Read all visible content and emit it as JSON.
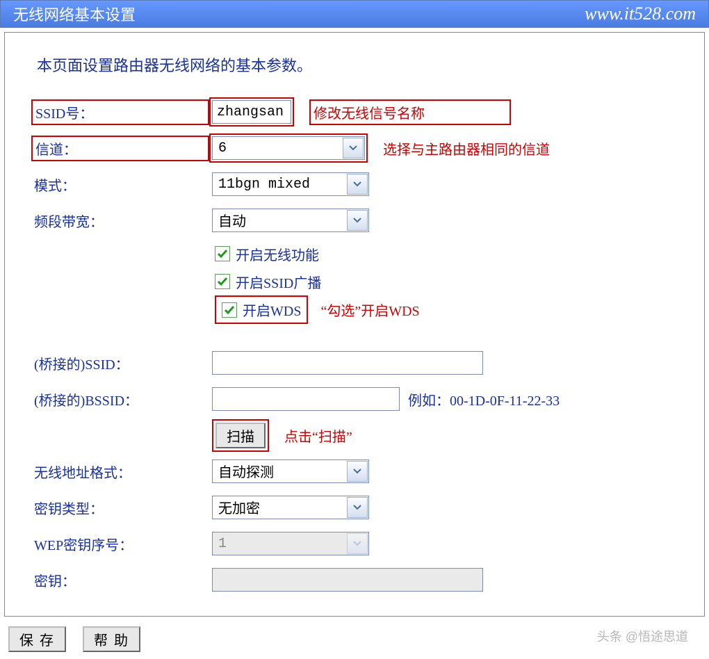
{
  "titlebar": {
    "title": "无线网络基本设置",
    "site": "www.it528.com"
  },
  "intro": "本页面设置路由器无线网络的基本参数。",
  "fields": {
    "ssid": {
      "label": "SSID号：",
      "value": "zhangsan",
      "note": "修改无线信号名称"
    },
    "channel": {
      "label": "信道：",
      "value": "6",
      "note": "选择与主路由器相同的信道"
    },
    "mode": {
      "label": "模式：",
      "value": "11bgn mixed"
    },
    "bandwidth": {
      "label": "频段带宽：",
      "value": "自动"
    },
    "cb_wireless": "开启无线功能",
    "cb_ssid": "开启SSID广播",
    "cb_wds": "开启WDS",
    "cb_wds_note": "“勾选”开启WDS",
    "bridge_ssid": {
      "label": "(桥接的)SSID：",
      "value": ""
    },
    "bridge_bssid": {
      "label": "(桥接的)BSSID：",
      "value": "",
      "hint": "例如：00-1D-0F-11-22-33"
    },
    "scan": {
      "label": "扫描",
      "note": "点击“扫描”"
    },
    "addr_fmt": {
      "label": "无线地址格式：",
      "value": "自动探测"
    },
    "key_type": {
      "label": "密钥类型：",
      "value": "无加密"
    },
    "wep_idx": {
      "label": "WEP密钥序号：",
      "value": "1"
    },
    "key": {
      "label": "密钥：",
      "value": ""
    }
  },
  "footer": {
    "save": "保 存",
    "help": "帮 助"
  },
  "watermark": "头条 @悟途思道"
}
